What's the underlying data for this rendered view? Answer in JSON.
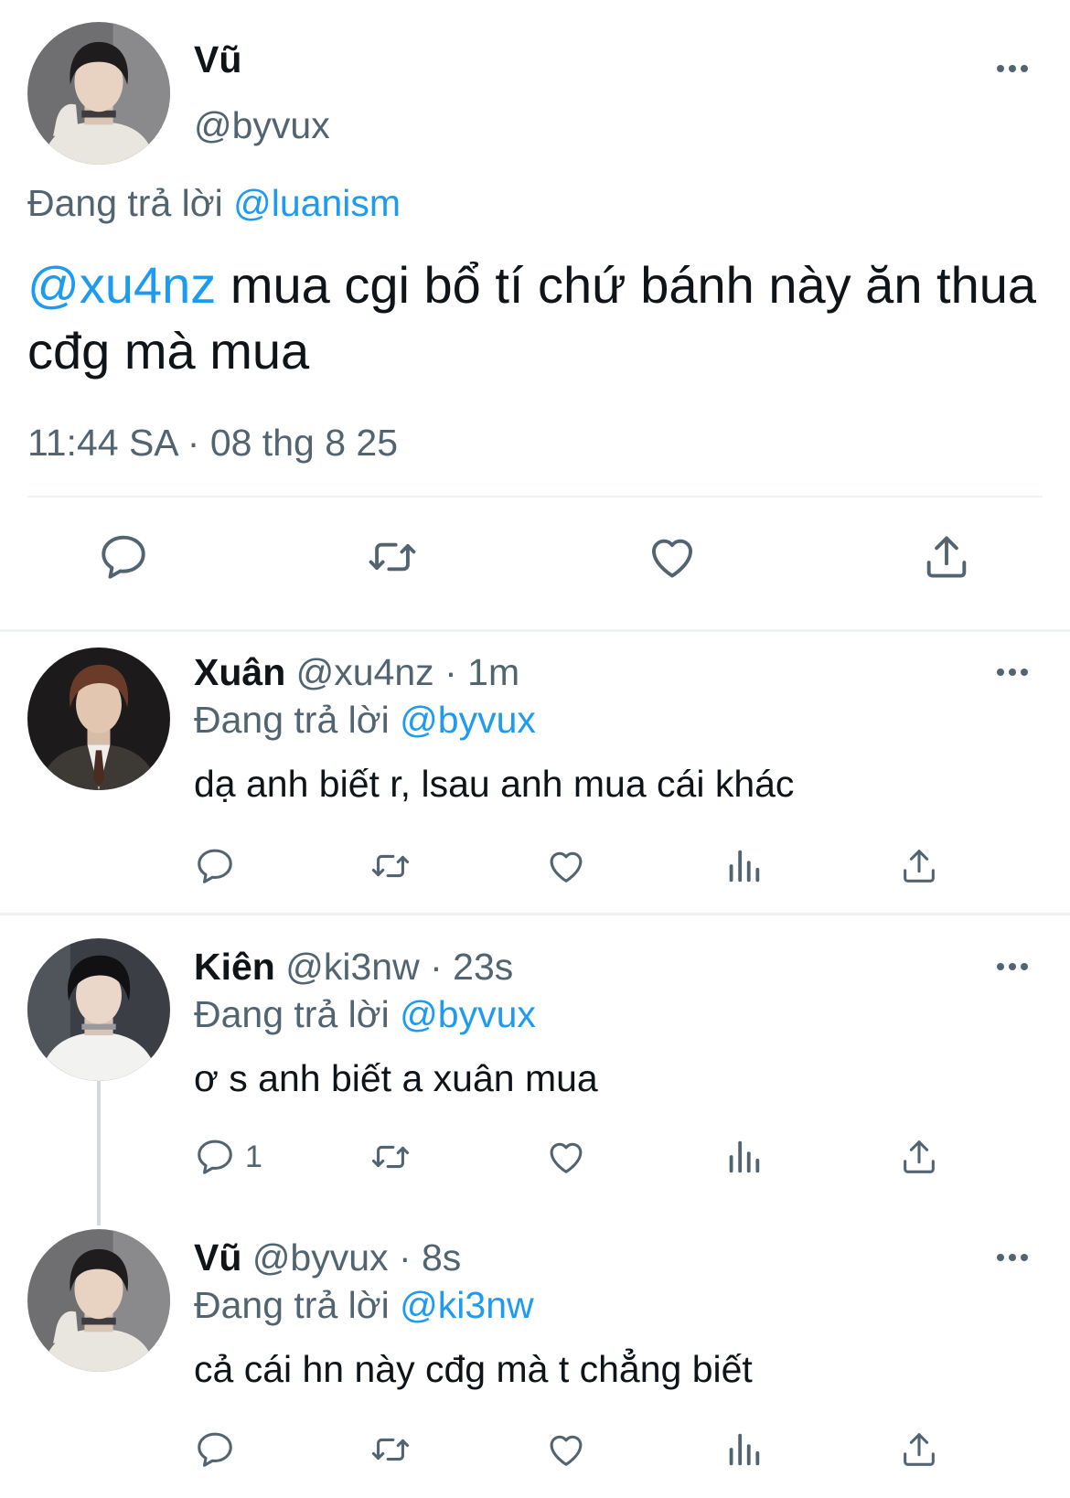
{
  "main_tweet": {
    "name": "Vũ",
    "handle": "@byvux",
    "replying_prefix": "Đang trả lời",
    "replying_to": "@luanism",
    "mention": "@xu4nz",
    "text": " mua cgi bổ tí chứ bánh này ăn thua cđg mà mua",
    "timestamp": "11:44 SA · 08 thg 8 25"
  },
  "replies": [
    {
      "name": "Xuân",
      "handle": "@xu4nz",
      "time": "· 1m",
      "replying_prefix": "Đang trả lời",
      "replying_to": "@byvux",
      "text": "dạ anh biết r, lsau anh mua cái khác",
      "reply_count": ""
    },
    {
      "name": "Kiên",
      "handle": "@ki3nw",
      "time": "· 23s",
      "replying_prefix": "Đang trả lời",
      "replying_to": "@byvux",
      "text": "ơ s anh biết a xuân mua",
      "reply_count": "1"
    },
    {
      "name": "Vũ",
      "handle": "@byvux",
      "time": "· 8s",
      "replying_prefix": "Đang trả lời",
      "replying_to": "@ki3nw",
      "text": "cả cái hn này cđg mà t chẳng biết",
      "reply_count": ""
    }
  ],
  "icons": {
    "reply": "reply-icon",
    "retweet": "retweet-icon",
    "like": "like-icon",
    "views": "views-icon",
    "share": "share-icon",
    "more": "more-icon"
  },
  "colors": {
    "link": "#1d9bf0",
    "muted": "#536471",
    "text": "#0f1419",
    "divider": "#eff3f4"
  }
}
